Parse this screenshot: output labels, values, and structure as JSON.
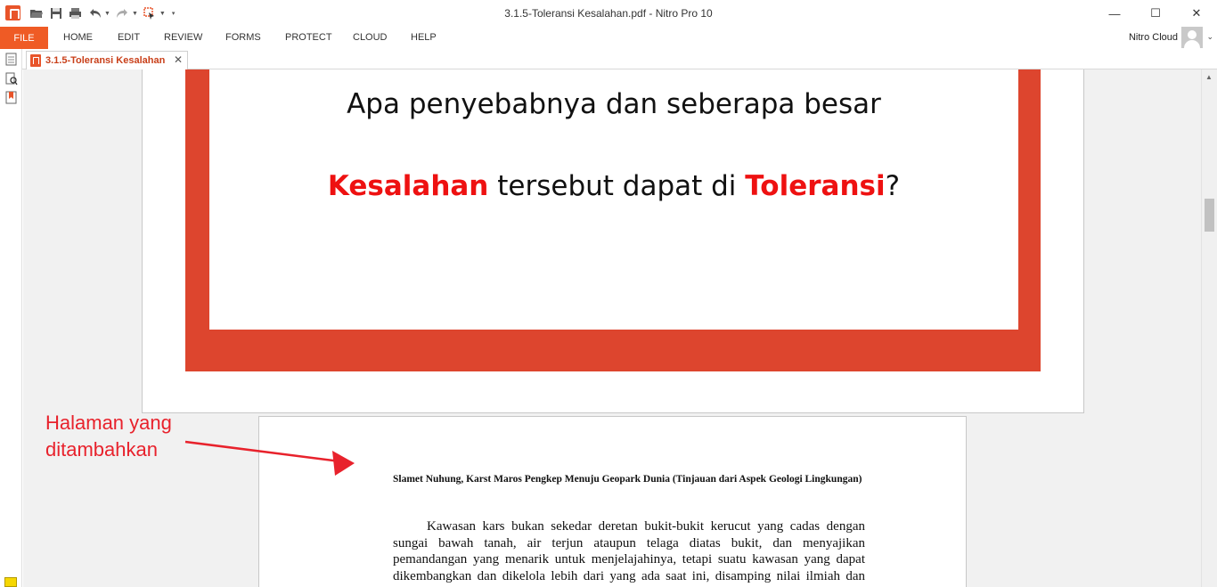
{
  "window": {
    "title": "3.1.5-Toleransi Kesalahan.pdf - Nitro Pro 10",
    "minimize": "—",
    "maximize": "☐",
    "close": "✕"
  },
  "qat": {
    "icons": [
      "open-folder-icon",
      "save-icon",
      "print-icon",
      "undo-icon",
      "redo-icon",
      "select-icon",
      "customize-icon"
    ]
  },
  "ribbon": {
    "file_tab": "FILE",
    "tabs": [
      "HOME",
      "EDIT",
      "REVIEW",
      "FORMS",
      "PROTECT",
      "CLOUD",
      "HELP"
    ],
    "cloud_user": "Nitro Cloud",
    "caret": "⌄"
  },
  "document_tab": {
    "label": "3.1.5-Toleransi Kesalahan",
    "close": "✕"
  },
  "slide": {
    "line1": "Apa penyebabnya dan seberapa besar",
    "line2_red1": "Kesalahan",
    "line2_mid": " tersebut dapat di ",
    "line2_red2": "Toleransi",
    "line2_end": "?"
  },
  "page2": {
    "title": "Slamet Nuhung, Karst Maros Pengkep Menuju Geopark Dunia (Tinjauan dari Aspek Geologi Lingkungan)",
    "body": "Kawasan kars bukan sekedar deretan bukit-bukit kerucut yang cadas dengan sungai bawah tanah, air terjun ataupun telaga diatas bukit, dan menyajikan pemandangan yang menarik untuk menjelajahinya, tetapi suatu kawasan yang dapat dikembangkan dan dikelola lebih dari yang ada saat ini, disamping nilai ilmiah dan ekonomisnya. Dengan nilai keindahan yang dimilikinya maka kawasan kars"
  },
  "annotation": {
    "line1": "Halaman yang",
    "line2": "ditambahkan",
    "color": "#e8222c"
  },
  "colors": {
    "accent": "#ef5b25",
    "slide_frame": "#dd452e",
    "slide_red_text": "#ee1111"
  }
}
